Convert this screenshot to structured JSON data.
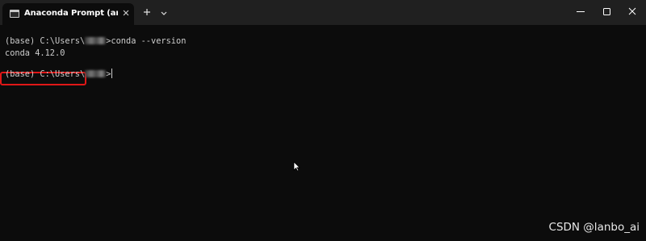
{
  "window": {
    "tab_title": "Anaconda Prompt (anaconda)",
    "tab_close_icon": "close-icon",
    "new_tab_icon": "plus-icon",
    "dropdown_icon": "chevron-down-icon",
    "controls": {
      "minimize_icon": "minimize-icon",
      "maximize_icon": "maximize-icon",
      "close_icon": "close-icon"
    }
  },
  "terminal": {
    "line1": {
      "prefix": "(base) C:\\Users\\",
      "suffix": ">conda --version"
    },
    "line2": "conda 4.12.0",
    "line3": {
      "prefix": "(base) C:\\Users\\",
      "suffix": ">"
    },
    "highlight_color": "#e01717"
  },
  "watermark": "CSDN @lanbo_ai",
  "colors": {
    "titlebar_bg": "#202020",
    "terminal_bg": "#0c0c0c",
    "text": "#cccccc"
  }
}
